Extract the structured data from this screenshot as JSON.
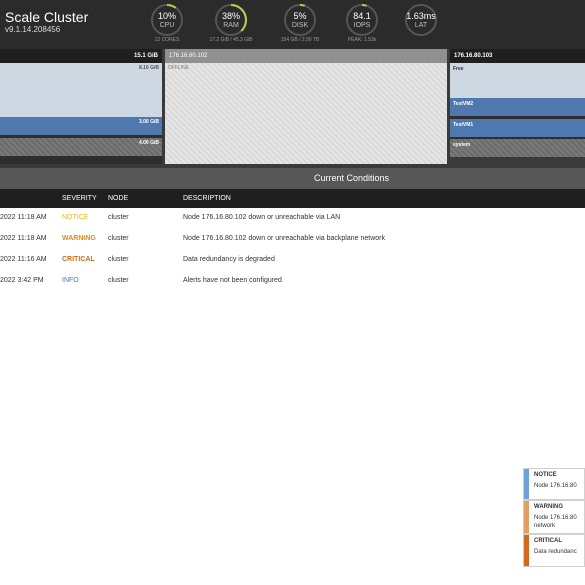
{
  "app": {
    "title": "Scale Cluster",
    "version": "v9.1.14.208456"
  },
  "gauges": [
    {
      "value": "10%",
      "label": "CPU",
      "sub": "12 CORES",
      "level": 0.1
    },
    {
      "value": "38%",
      "label": "RAM",
      "sub": "17.2 GiB / 45.3 GiB",
      "level": 0.38
    },
    {
      "value": "5%",
      "label": "DISK",
      "sub": "154 GB / 2.90 TB",
      "level": 0.05
    },
    {
      "value": "84.1",
      "label": "IOPS",
      "sub": "PEAK: 1.53k",
      "level": 0.05
    },
    {
      "value": "1.63ms",
      "label": "LAT",
      "sub": "",
      "level": 0.0
    }
  ],
  "colors": {
    "gauge_track": "#555555",
    "gauge_fill": "#b7d24a",
    "notice": "#f0b428",
    "warning": "#e08a1e",
    "critical": "#d2691e",
    "info": "#3b7bbf"
  },
  "nodes": {
    "left": {
      "total": "15.1 GiB",
      "free": "8.10 GiB",
      "vm": "3.00 GiB",
      "system": "4.00 GiB"
    },
    "middle": {
      "ip": "176.16.80.102",
      "status": "OFFLINE"
    },
    "right": {
      "ip": "176.16.80.103",
      "free": "Free",
      "vm2": "TestVM2",
      "vm1": "TestVM1",
      "system": "system"
    }
  },
  "conditions": {
    "title": "Current Conditions",
    "headers": {
      "severity": "SEVERITY",
      "node": "NODE",
      "description": "DESCRIPTION"
    },
    "rows": [
      {
        "time": "2022 11:18 AM",
        "severity": "NOTICE",
        "node": "cluster",
        "description": "Node 176.16.80.102 down or unreachable via LAN"
      },
      {
        "time": "2022 11:18 AM",
        "severity": "WARNING",
        "node": "cluster",
        "description": "Node 176.16.80.102 down or unreachable via backplane network"
      },
      {
        "time": "2022 11:16 AM",
        "severity": "CRITICAL",
        "node": "cluster",
        "description": "Data redundancy is degraded"
      },
      {
        "time": "2022 3:42 PM",
        "severity": "INFO",
        "node": "cluster",
        "description": "Alerts have not been configured"
      }
    ]
  },
  "toasts": [
    {
      "title": "NOTICE",
      "body": "Node 176.16.80"
    },
    {
      "title": "WARNING",
      "body": "Node 176.16.80 network"
    },
    {
      "title": "CRITICAL",
      "body": "Data redundanc"
    }
  ]
}
